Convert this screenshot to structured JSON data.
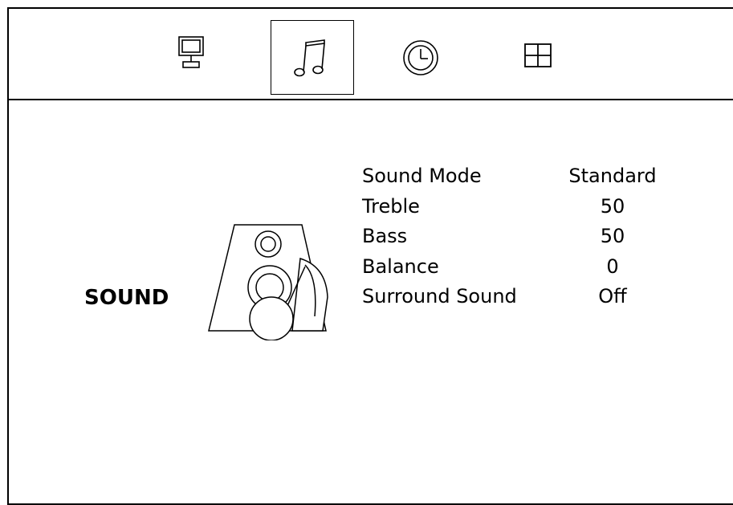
{
  "tabs": [
    {
      "icon": "monitor-icon",
      "active": false
    },
    {
      "icon": "music-note-icon",
      "active": true
    },
    {
      "icon": "clock-icon",
      "active": false
    },
    {
      "icon": "grid-icon",
      "active": false
    }
  ],
  "section": {
    "title": "SOUND",
    "icon": "speaker-icon"
  },
  "settings": [
    {
      "label": "Sound Mode",
      "value": "Standard"
    },
    {
      "label": "Treble",
      "value": "50"
    },
    {
      "label": "Bass",
      "value": "50"
    },
    {
      "label": "Balance",
      "value": "0"
    },
    {
      "label": "Surround Sound",
      "value": "Off"
    }
  ]
}
